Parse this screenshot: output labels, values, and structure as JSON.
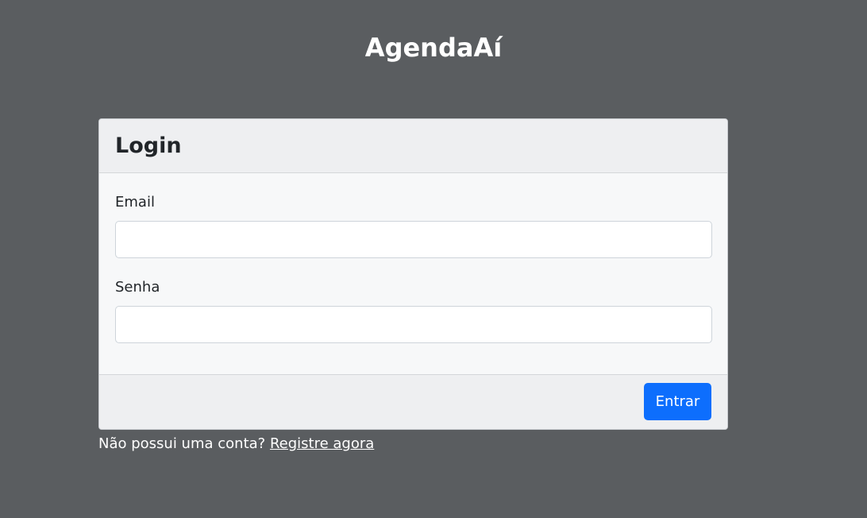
{
  "app": {
    "title": "AgendaAí"
  },
  "login_card": {
    "title": "Login",
    "fields": [
      {
        "label": "Email",
        "value": "",
        "placeholder": ""
      },
      {
        "label": "Senha",
        "value": "",
        "placeholder": ""
      }
    ],
    "submit_label": "Entrar"
  },
  "register": {
    "prompt": "Não possui uma conta?",
    "link_label": "Registre agora"
  },
  "colors": {
    "background": "#5a5d60",
    "primary": "#0d6efd",
    "card_body": "#f7f8f9",
    "card_header": "#eeeff1"
  }
}
